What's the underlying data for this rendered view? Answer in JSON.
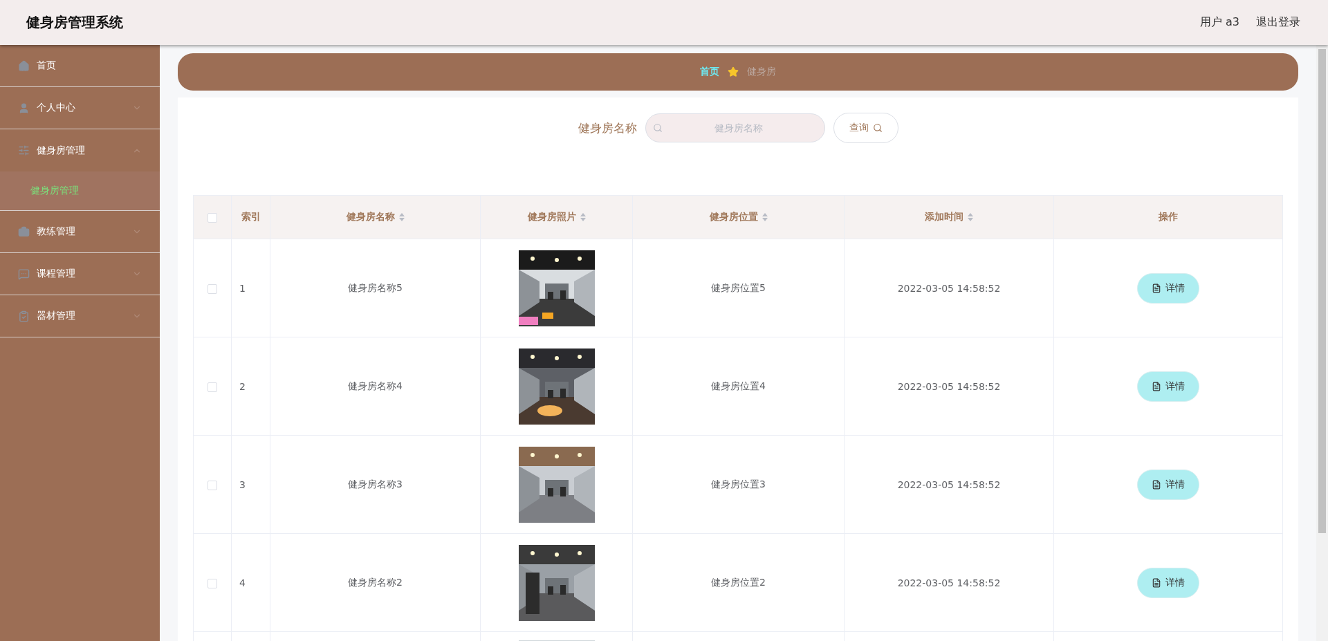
{
  "header": {
    "title": "健身房管理系统",
    "user": "用户 a3",
    "logout": "退出登录"
  },
  "sidebar": {
    "items": [
      {
        "label": "首页",
        "kind": "home"
      },
      {
        "label": "个人中心",
        "kind": "user",
        "expanded": false
      },
      {
        "label": "健身房管理",
        "kind": "sliders",
        "expanded": true,
        "children": [
          {
            "label": "健身房管理",
            "selected": true
          }
        ]
      },
      {
        "label": "教练管理",
        "kind": "briefcase",
        "expanded": false
      },
      {
        "label": "课程管理",
        "kind": "message",
        "expanded": false
      },
      {
        "label": "器材管理",
        "kind": "clipboard",
        "expanded": false
      }
    ]
  },
  "breadcrumb": [
    {
      "label": "首页",
      "kind": "link"
    },
    {
      "label": "健身房",
      "kind": "current"
    }
  ],
  "search": {
    "label": "健身房名称",
    "placeholder": "健身房名称",
    "button": "查询"
  },
  "table": {
    "columns": [
      {
        "kind": "checkbox",
        "checked": false
      },
      {
        "kind": "text",
        "label": "索引",
        "sortable": false
      },
      {
        "kind": "text",
        "label": "健身房名称",
        "sortable": true
      },
      {
        "kind": "text",
        "label": "健身房照片",
        "sortable": true
      },
      {
        "kind": "text",
        "label": "健身房位置",
        "sortable": true
      },
      {
        "kind": "text",
        "label": "添加时间",
        "sortable": true
      },
      {
        "kind": "text",
        "label": "操作",
        "sortable": false
      }
    ],
    "rows": [
      {
        "checked": false,
        "index": "1",
        "name": "健身房名称5",
        "location": "健身房位置5",
        "time": "2022-03-05 14:58:52",
        "action": "详情"
      },
      {
        "checked": false,
        "index": "2",
        "name": "健身房名称4",
        "location": "健身房位置4",
        "time": "2022-03-05 14:58:52",
        "action": "详情"
      },
      {
        "checked": false,
        "index": "3",
        "name": "健身房名称3",
        "location": "健身房位置3",
        "time": "2022-03-05 14:58:52",
        "action": "详情"
      },
      {
        "checked": false,
        "index": "4",
        "name": "健身房名称2",
        "location": "健身房位置2",
        "time": "2022-03-05 14:58:52",
        "action": "详情"
      }
    ]
  }
}
